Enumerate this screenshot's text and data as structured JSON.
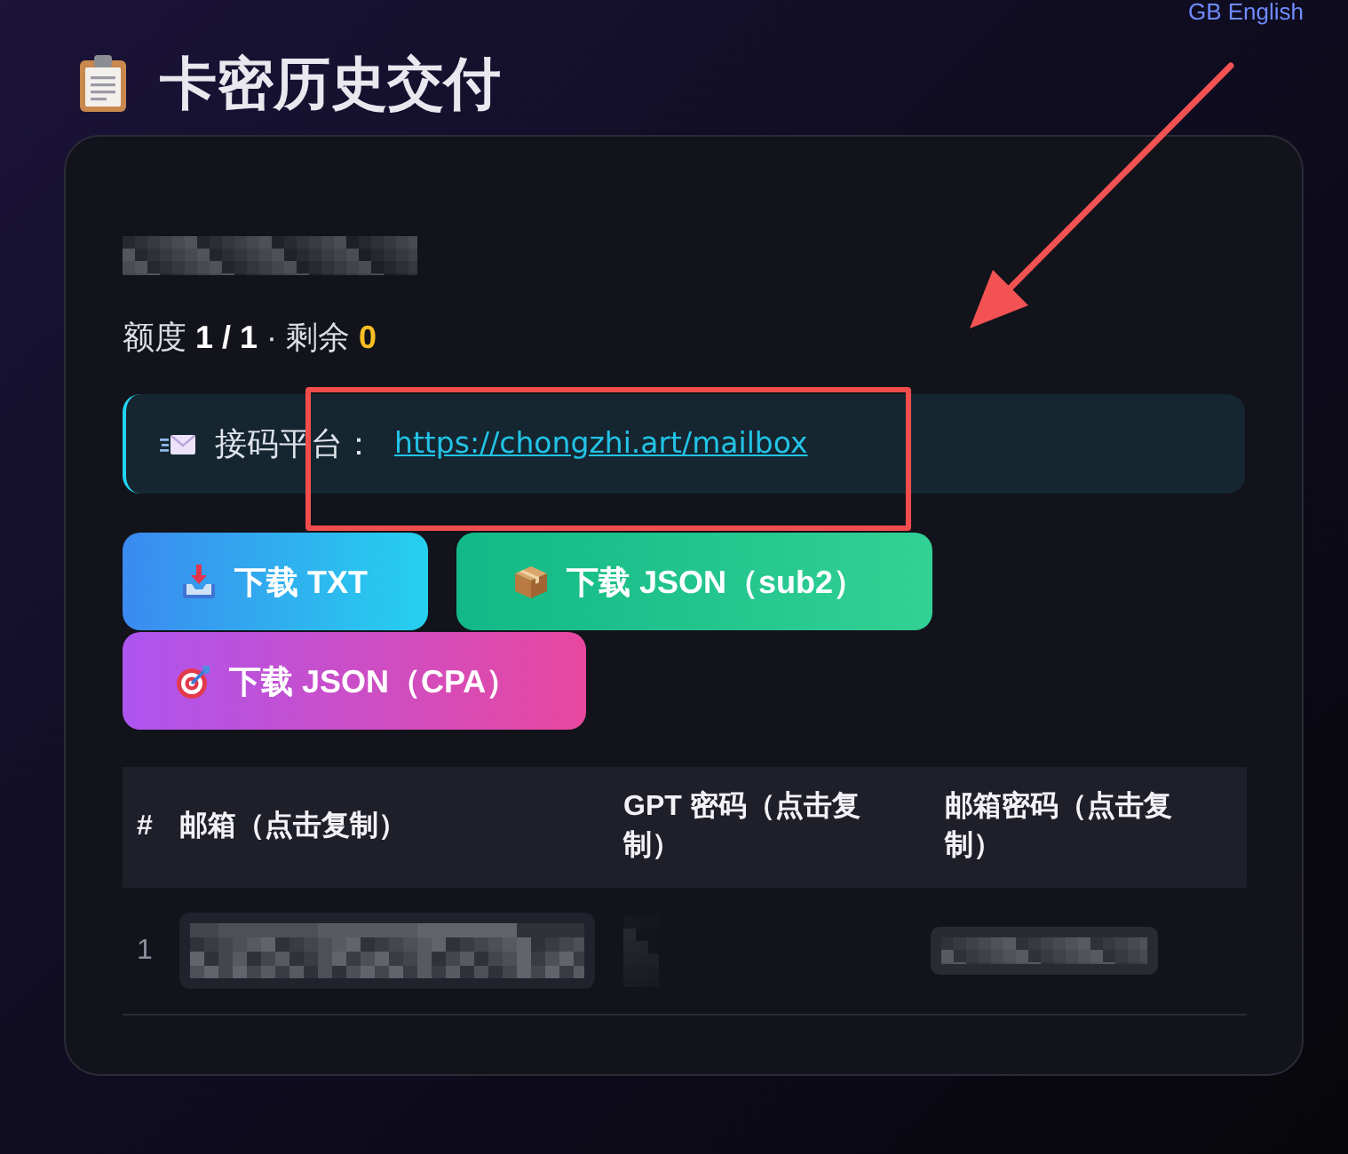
{
  "language_link": {
    "label": "GB English"
  },
  "title": {
    "text": "卡密历史交付"
  },
  "card": {
    "account_redacted": true,
    "quota": "额度 **1 / 1** · 剩余 **0**",
    "notice": {
      "label": "接码平台：",
      "link": "https://chongzhi.art/mailbox"
    },
    "buttons": [
      {
        "kind": "txt",
        "label": "下载 TXT"
      },
      {
        "kind": "sub2",
        "label": "下载 JSON（sub2）"
      },
      {
        "kind": "cpa",
        "label": "下载 JSON（CPA）"
      }
    ],
    "table": {
      "columns": [
        "#",
        "邮箱（点击复制）",
        "GPT 密码（点击复制）",
        "邮箱密码（点击复制）"
      ],
      "rows": [
        {
          "number": "1",
          "email_redacted": true,
          "gpt_password_redacted": true,
          "mailbox_password_redacted": true
        }
      ]
    }
  },
  "annotations": {
    "highlight_rectangle": true,
    "arrow": true
  }
}
